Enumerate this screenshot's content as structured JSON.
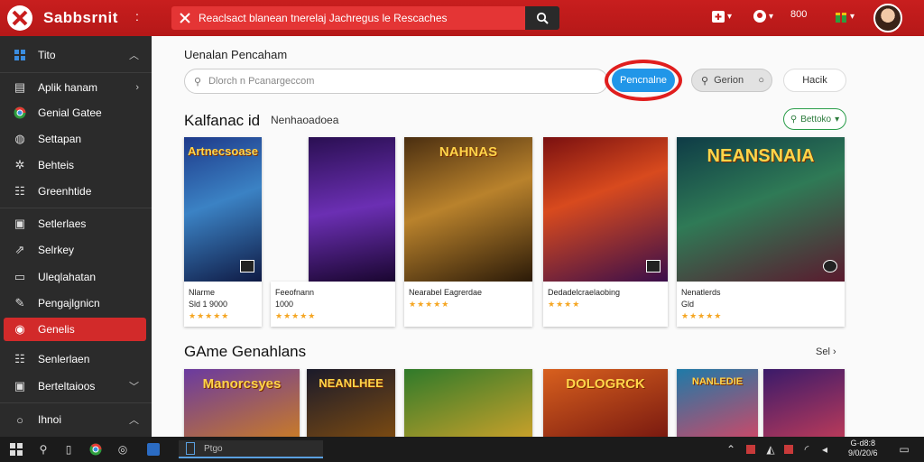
{
  "app": {
    "name": "Sabbsrnit",
    "menu_glyph": ":"
  },
  "header": {
    "search_text": "Reaclsact blanean tnerelaj Jachregus le Rescaches",
    "badge_count": "800"
  },
  "sidebar": {
    "items": [
      {
        "label": "Tito",
        "icon": "grid-icon",
        "arrow": "︿"
      },
      {
        "label": "Aplik hanam",
        "icon": "doc-icon",
        "arrow": "›"
      },
      {
        "label": "Genial Gatee",
        "icon": "chrome-icon",
        "arrow": ""
      },
      {
        "label": "Settapan",
        "icon": "circle-icon",
        "arrow": ""
      },
      {
        "label": "Behteis",
        "icon": "star-icon",
        "arrow": ""
      },
      {
        "label": "Greenhtide",
        "icon": "list-icon",
        "arrow": ""
      },
      {
        "label": "Setlerlaes",
        "icon": "box-icon",
        "arrow": ""
      },
      {
        "label": "Selrkey",
        "icon": "link-icon",
        "arrow": ""
      },
      {
        "label": "Uleqlahatan",
        "icon": "page-icon",
        "arrow": ""
      },
      {
        "label": "Pengajlgnicn",
        "icon": "edit-icon",
        "arrow": ""
      },
      {
        "label": "Genelis",
        "icon": "gamepad-icon",
        "arrow": "",
        "active": true
      },
      {
        "label": "Senlerlaen",
        "icon": "list-icon",
        "arrow": ""
      },
      {
        "label": "Berteltaioos",
        "icon": "box-icon",
        "arrow": "﹀"
      },
      {
        "label": "Ihnoi",
        "icon": "circle-icon",
        "arrow": "︿"
      }
    ]
  },
  "main": {
    "title": "Uenalan Pencaham",
    "search_placeholder": "Dlorch n Pcanargeccom",
    "primary_button": "Pencnalne",
    "sort_button": "Gerion",
    "h_button": "Hacik",
    "section1_title": "Kalfanac id",
    "section1_subtab": "Nenhaoadoea",
    "filter_button": "Bettoko",
    "cards": [
      {
        "art_title": "Artnecsoase",
        "name": "Nlarme",
        "meta": "Sld 1 9000",
        "rating": "★★★★★"
      },
      {
        "art_title": "",
        "name": "Feeofnann",
        "meta": "1000",
        "rating": "★★★★★"
      },
      {
        "art_title": "NAHNAS",
        "name": "Nearabel Eagrerdae",
        "meta": "",
        "rating": "★★★★★"
      },
      {
        "art_title": "",
        "name": "Dedadelcraelaobing",
        "meta": "",
        "rating": "★★★★"
      },
      {
        "art_title": "NEANSNAIA",
        "name": "Nenatlerds",
        "meta": "Gld",
        "rating": "★★★★★"
      }
    ],
    "section2_title": "GAme Genahlans",
    "see_all": "Sel",
    "row2_titles": [
      "Manorcsyes",
      "NEANLHEE",
      "",
      "DOLOGRCK",
      "NANLEDIE",
      ""
    ]
  },
  "taskbar": {
    "search_label": "Ptgo",
    "clock_time": "G·d8:8",
    "clock_date": "9/0/20/6"
  },
  "colors": {
    "brand": "#c81e1e",
    "accent_blue": "#2196e8",
    "sidebar_bg": "#2b2b2b"
  }
}
